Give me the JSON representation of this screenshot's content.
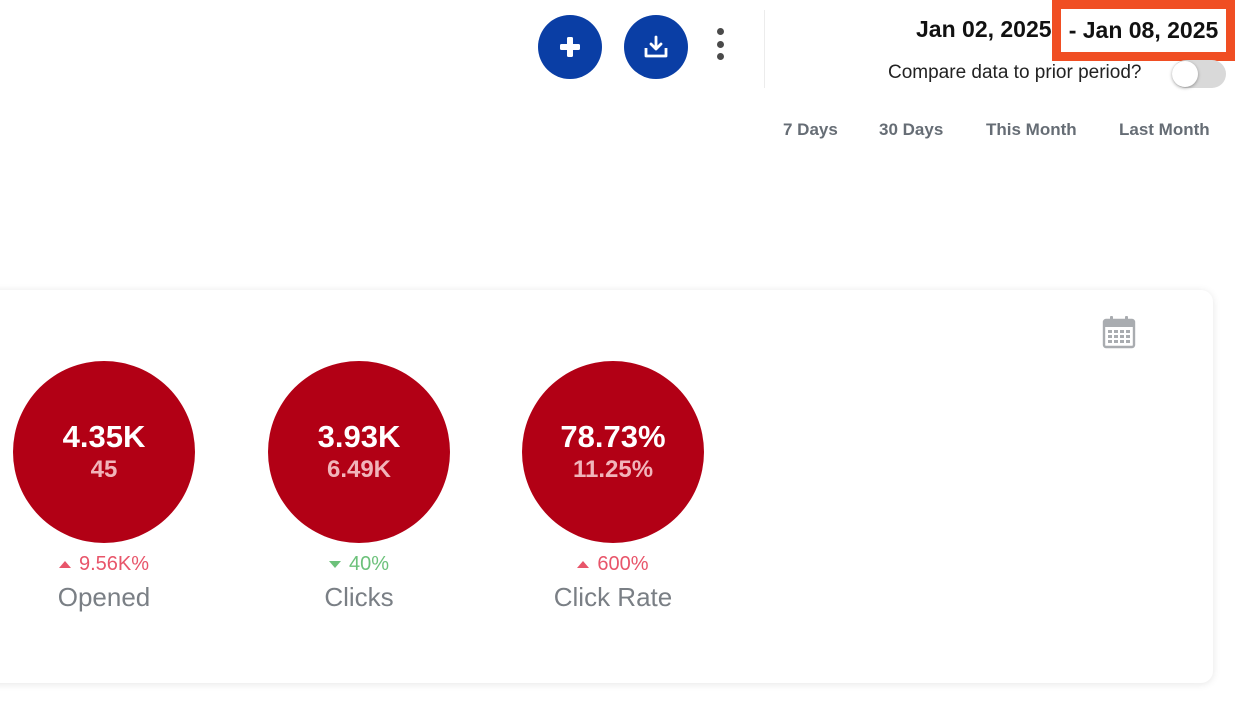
{
  "header": {
    "date_start": "Jan 02, 2025",
    "date_end": "- Jan 08, 2025",
    "compare_label": "Compare data to prior period?",
    "compare_enabled": false,
    "quick_ranges": [
      "7 Days",
      "30 Days",
      "This Month",
      "Last Month"
    ],
    "add_icon": "plus-icon",
    "download_icon": "download-icon",
    "more_icon": "more-vertical-icon"
  },
  "card": {
    "calendar_icon": "calendar-icon",
    "stats": [
      {
        "label": "Opened",
        "value": "4.35K",
        "previous": "45",
        "change": "9.56K%",
        "direction": "up"
      },
      {
        "label": "Clicks",
        "value": "3.93K",
        "previous": "6.49K",
        "change": "40%",
        "direction": "down"
      },
      {
        "label": "Click Rate",
        "value": "78.73%",
        "previous": "11.25%",
        "change": "600%",
        "direction": "up"
      }
    ]
  },
  "colors": {
    "primary_button": "#0a3ea5",
    "stat_circle": "#b20015",
    "increase": "#e8556a",
    "decrease": "#6cc17a",
    "highlight": "#f04e23"
  }
}
